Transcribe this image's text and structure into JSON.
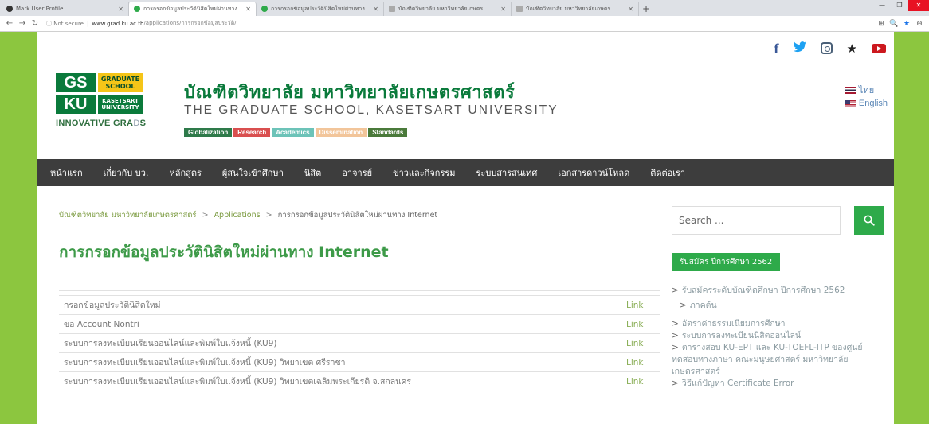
{
  "browser": {
    "tabs": [
      {
        "label": "Mark User Profile",
        "active": false,
        "color": "#333333"
      },
      {
        "label": "การกรอกข้อมูลประวัตินิสิตใหม่ผ่านทาง",
        "active": true,
        "color": "#2eaa4a"
      },
      {
        "label": "การกรอกข้อมูลประวัตินิสิตใหม่ผ่านทาง",
        "active": false,
        "color": "#2eaa4a"
      },
      {
        "label": "บัณฑิตวิทยาลัย มหาวิทยาลัยเกษตร",
        "active": false,
        "color": "#888888"
      },
      {
        "label": "บัณฑิตวิทยาลัย มหาวิทยาลัยเกษตร",
        "active": false,
        "color": "#888888"
      }
    ],
    "new_tab": "+",
    "window_controls": [
      "—",
      "❐",
      "✕"
    ],
    "security": "ⓘ Not secure",
    "url_host": "www.grad.ku.ac.th",
    "url_path": "/applications/การกรอกข้อมูลประวัติ/",
    "toolbar_icons": [
      "⊞",
      "🔍",
      "★",
      "⊖"
    ]
  },
  "social": {
    "facebook": "f",
    "twitter": "🐦",
    "star": "★"
  },
  "logo": {
    "gs": "GS",
    "graduate_school": "GRADUATE SCHOOL",
    "ku": "KU",
    "kasetsart": "KASETSART UNIVERSITY",
    "innovative": "INNOVATIVE GRA",
    "grads_accent": "D",
    "grads_end": "S"
  },
  "header": {
    "title_th": "บัณฑิตวิทยาลัย มหาวิทยาลัยเกษตรศาสตร์",
    "title_en": "THE GRADUATE SCHOOL, KASETSART UNIVERSITY",
    "pills": [
      {
        "label": "Globalization",
        "color": "#2e7a4a"
      },
      {
        "label": "Research",
        "color": "#d94f4f"
      },
      {
        "label": "Academics",
        "color": "#6cc3b8"
      },
      {
        "label": "Dissemination",
        "color": "#f2c59a"
      },
      {
        "label": "Standards",
        "color": "#4a7a3a"
      }
    ],
    "lang_th": "ไทย",
    "lang_en": "English"
  },
  "nav": {
    "items": [
      "หน้าแรก",
      "เกี่ยวกับ บว.",
      "หลักสูตร",
      "ผู้สนใจเข้าศึกษา",
      "นิสิต",
      "อาจารย์",
      "ข่าวและกิจกรรม",
      "ระบบสารสนเทศ",
      "เอกสารดาวน์โหลด",
      "ติดต่อเรา"
    ]
  },
  "breadcrumb": {
    "home": "บัณฑิตวิทยาลัย มหาวิทยาลัยเกษตรศาสตร์",
    "section": "Applications",
    "current": "การกรอกข้อมูลประวัตินิสิตใหม่ผ่านทาง Internet",
    "separator": ">"
  },
  "page_title": "การกรอกข้อมูลประวัตินิสิตใหม่ผ่านทาง Internet",
  "table": {
    "rows": [
      {
        "label": "กรอกข้อมูลประวัตินิสิตใหม่",
        "link": "Link"
      },
      {
        "label": "ขอ Account Nontri",
        "link": "Link"
      },
      {
        "label": "ระบบการลงทะเบียนเรียนออนไลน์และพิมพ์ใบแจ้งหนี้ (KU9)",
        "link": "Link"
      },
      {
        "label": "ระบบการลงทะเบียนเรียนออนไลน์และพิมพ์ใบแจ้งหนี้ (KU9) วิทยาเขต ศรีราชา",
        "link": "Link"
      },
      {
        "label": "ระบบการลงทะเบียนเรียนออนไลน์และพิมพ์ใบแจ้งหนี้ (KU9) วิทยาเขตเฉลิมพระเกียรติ จ.สกลนคร",
        "link": "Link"
      }
    ]
  },
  "sidebar": {
    "search_placeholder": "Search ...",
    "heading": "รับสมัคร ปีการศึกษา 2562",
    "links": [
      {
        "caret": ">",
        "text": "รับสมัครระดับบัณฑิตศึกษา ปีการศึกษา 2562"
      },
      {
        "caret": ">",
        "text": "ภาคต้น",
        "sub": true
      },
      {
        "caret": ">",
        "text": "อัตราค่าธรรมเนียมการศึกษา"
      },
      {
        "caret": ">",
        "text": "ระบบการลงทะเบียนนิสิตออนไลน์"
      },
      {
        "caret": ">",
        "text": "ตารางสอบ KU-EPT และ KU-TOEFL-ITP ของศูนย์ทดสอบทางภาษา คณะมนุษยศาสตร์ มหาวิทยาลัยเกษตรศาสตร์"
      },
      {
        "caret": ">",
        "text": "วิธีแก้ปัญหา Certificate Error"
      }
    ]
  }
}
